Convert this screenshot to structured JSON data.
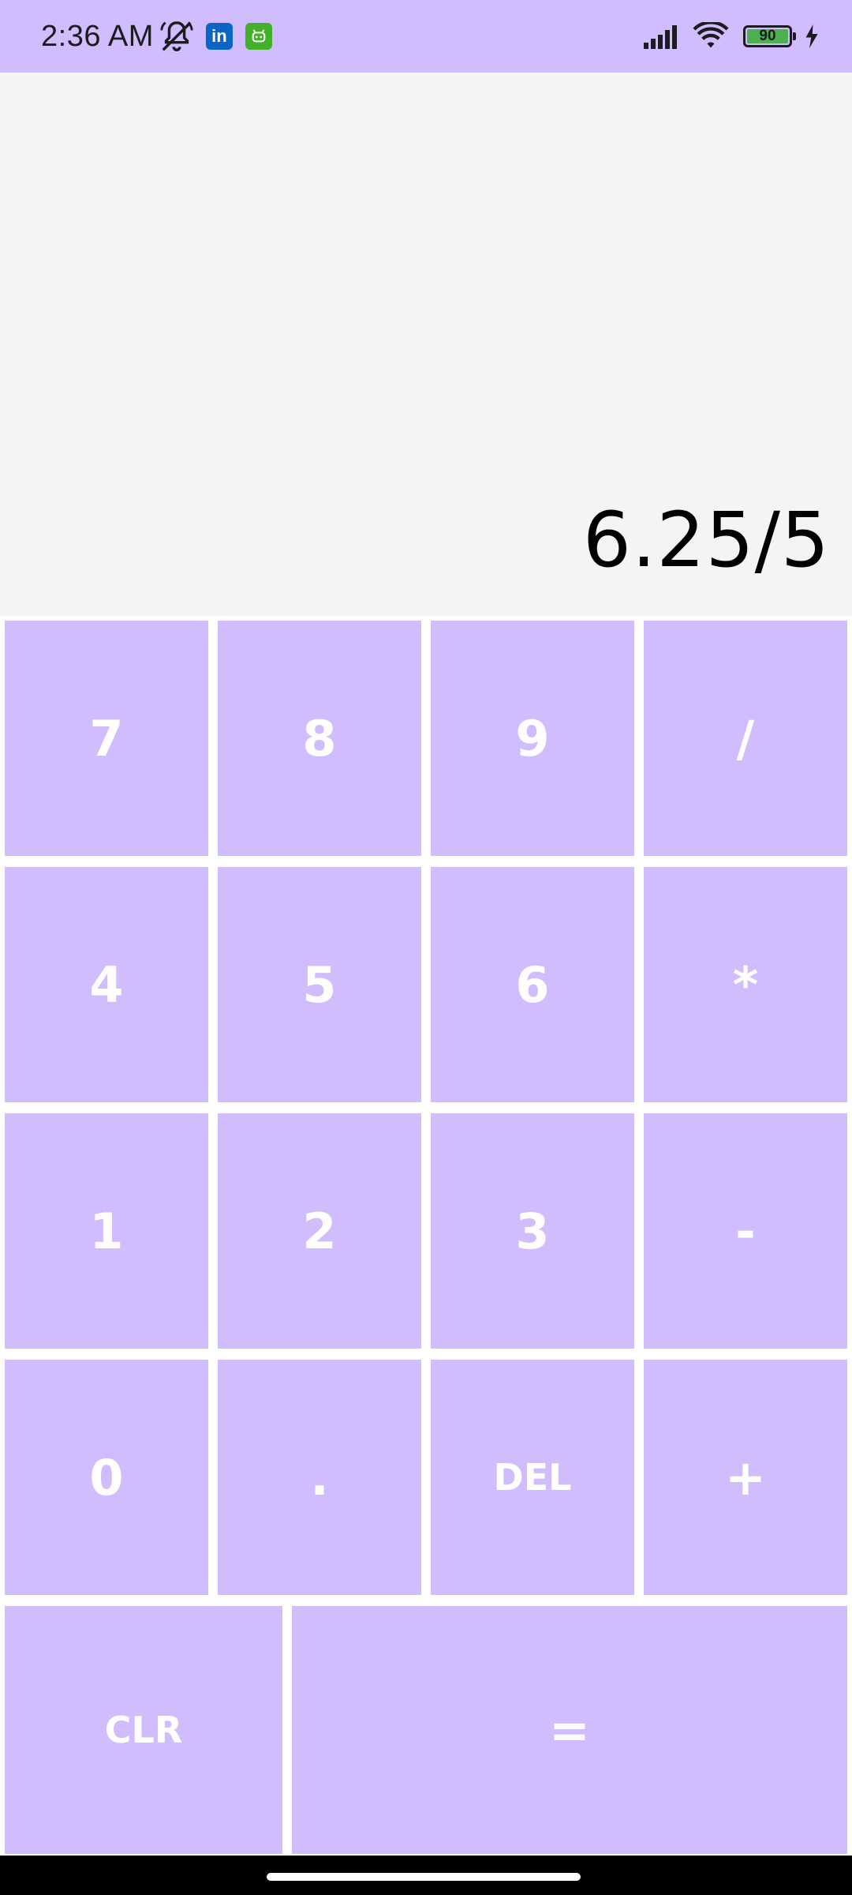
{
  "status_bar": {
    "time": "2:36 AM",
    "battery_level": "90",
    "notification_icons": [
      "muted-bell-icon",
      "linkedin-icon",
      "robot-app-icon"
    ],
    "system_icons": [
      "signal-icon",
      "wifi-icon",
      "battery-icon",
      "charging-icon"
    ]
  },
  "display": {
    "expression": "6.25/5"
  },
  "keypad": {
    "rows": [
      [
        "7",
        "8",
        "9",
        "/"
      ],
      [
        "4",
        "5",
        "6",
        "*"
      ],
      [
        "1",
        "2",
        "3",
        "-"
      ],
      [
        "0",
        ".",
        "DEL",
        "+"
      ]
    ],
    "clear_label": "CLR",
    "equals_label": "="
  },
  "colors": {
    "key_background": "#d1bcfd",
    "key_text": "#ffffff",
    "display_background": "#f4f4f4",
    "status_bar": "#d1bcfd"
  }
}
